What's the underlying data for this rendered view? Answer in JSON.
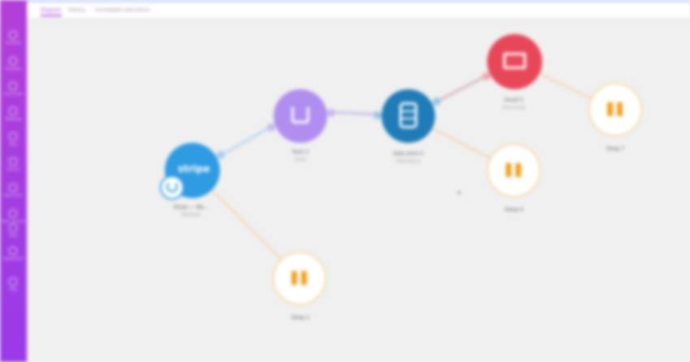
{
  "nav": {
    "items": [
      {
        "label": "Scenarios"
      },
      {
        "label": "Templates"
      },
      {
        "label": "Connections"
      },
      {
        "label": "Webhooks"
      },
      {
        "label": "Keys"
      },
      {
        "label": "Devices"
      },
      {
        "label": "Data stores"
      },
      {
        "label": "Data structures"
      },
      {
        "label": "Team"
      },
      {
        "label": "Organization"
      },
      {
        "label": "Help"
      }
    ]
  },
  "tabs": [
    {
      "label": "Diagram",
      "active": true
    },
    {
      "label": "History",
      "active": false
    },
    {
      "label": "Incomplete executions",
      "active": false
    }
  ],
  "colors": {
    "nav": "#a23ce2",
    "stripe": "#2f9be3",
    "tools": "#b08ef0",
    "datastore": "#1f7cb8",
    "email": "#e8475a",
    "sleep": "#f0a020"
  },
  "nodes": {
    "stripe": {
      "title": "Stripe — Wa...",
      "subtitle": "Webhook",
      "icon": "stripe-logo"
    },
    "tools": {
      "title": "Tools 3",
      "subtitle": "Sleep",
      "icon": "download-icon"
    },
    "datastore": {
      "title": "Data store 4",
      "subtitle": "Add/replace",
      "icon": "database-icon"
    },
    "email": {
      "title": "Email 5",
      "subtitle": "Send email",
      "icon": "envelope-icon"
    },
    "sleep1": {
      "title": "Sleep 2",
      "icon": "pause-icon"
    },
    "sleep2": {
      "title": "Sleep 6",
      "icon": "pause-icon"
    },
    "sleep3": {
      "title": "Sleep 7",
      "icon": "pause-icon"
    }
  }
}
